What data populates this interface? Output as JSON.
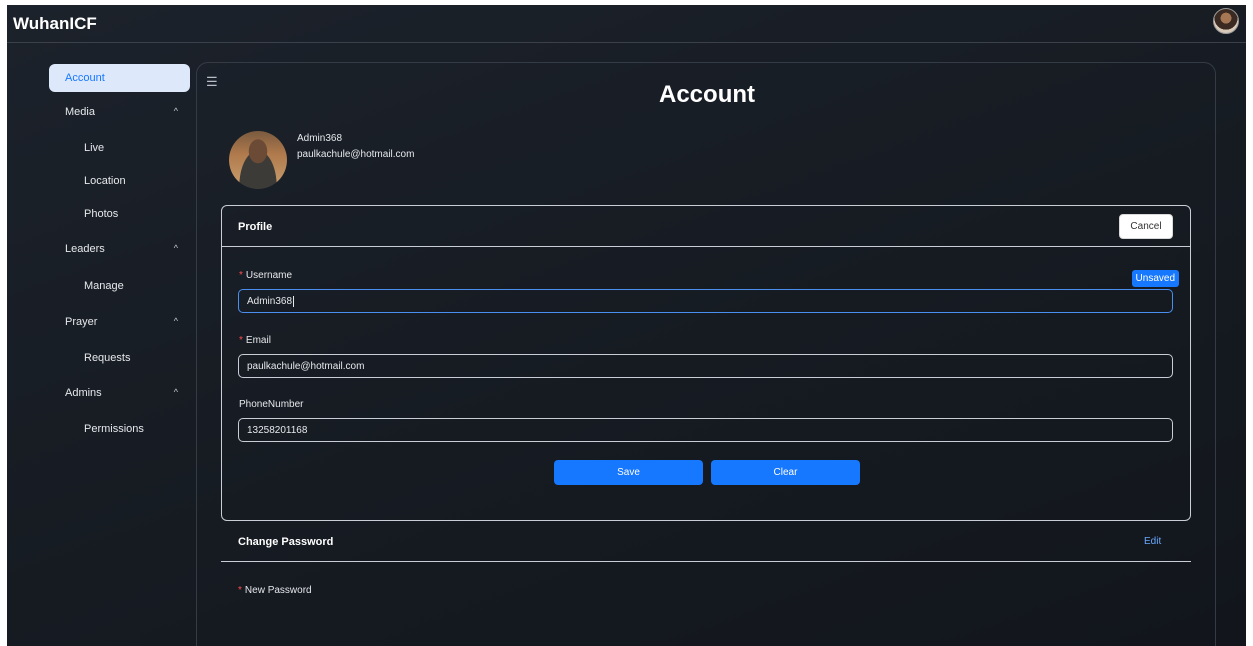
{
  "app": {
    "brand": "WuhanICF"
  },
  "sidebar": {
    "items": [
      {
        "label": "Account",
        "active": true
      },
      {
        "label": "Media",
        "expanded": true
      },
      {
        "label": "Live"
      },
      {
        "label": "Location"
      },
      {
        "label": "Photos"
      },
      {
        "label": "Leaders",
        "expanded": true
      },
      {
        "label": "Manage"
      },
      {
        "label": "Prayer",
        "expanded": true
      },
      {
        "label": "Requests"
      },
      {
        "label": "Admins",
        "expanded": true
      },
      {
        "label": "Permissions"
      }
    ],
    "chevron": "^"
  },
  "page": {
    "title": "Account"
  },
  "user": {
    "name": "Admin368",
    "email": "paulkachule@hotmail.com"
  },
  "profile": {
    "title": "Profile",
    "cancel_label": "Cancel",
    "status_badge": "Unsaved",
    "fields": {
      "username": {
        "label": "Username",
        "value": "Admin368",
        "required": true
      },
      "email": {
        "label": "Email",
        "value": "paulkachule@hotmail.com",
        "required": true
      },
      "phone": {
        "label": "PhoneNumber",
        "value": "13258201168",
        "required": false
      }
    },
    "required_mark": "*",
    "save_label": "Save",
    "clear_label": "Clear"
  },
  "change_password": {
    "title": "Change Password",
    "edit_label": "Edit",
    "new_password_label": "New Password"
  },
  "colors": {
    "primary": "#1677ff",
    "required": "#ff4d4f",
    "link": "#6aa8ff"
  },
  "icons": {
    "menu": "list-menu-icon",
    "chevron": "chevron-up-icon",
    "avatar": "user-avatar"
  }
}
